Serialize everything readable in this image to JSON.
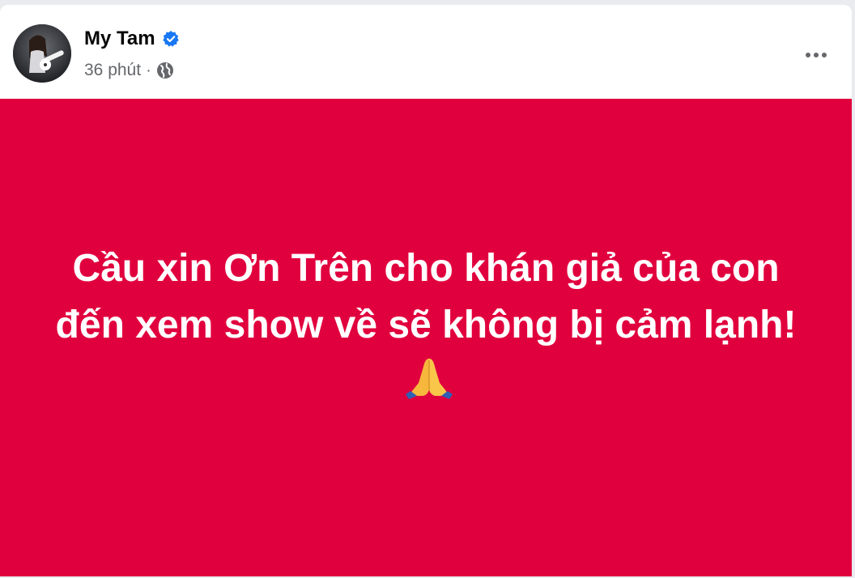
{
  "post": {
    "author": {
      "name": "My Tam",
      "verified": true,
      "avatar_icon": "profile-photo"
    },
    "meta": {
      "time": "36 phút",
      "separator": "·",
      "audience_icon": "globe-icon"
    },
    "more_icon": "more-options-icon",
    "banner": {
      "background_color": "#e1003e",
      "text_color": "#ffffff",
      "text": "Cầu xin Ơn Trên cho khán giả của con đến xem show về sẽ không bị cảm lạnh!",
      "emoji_icon": "folded-hands-emoji"
    }
  }
}
